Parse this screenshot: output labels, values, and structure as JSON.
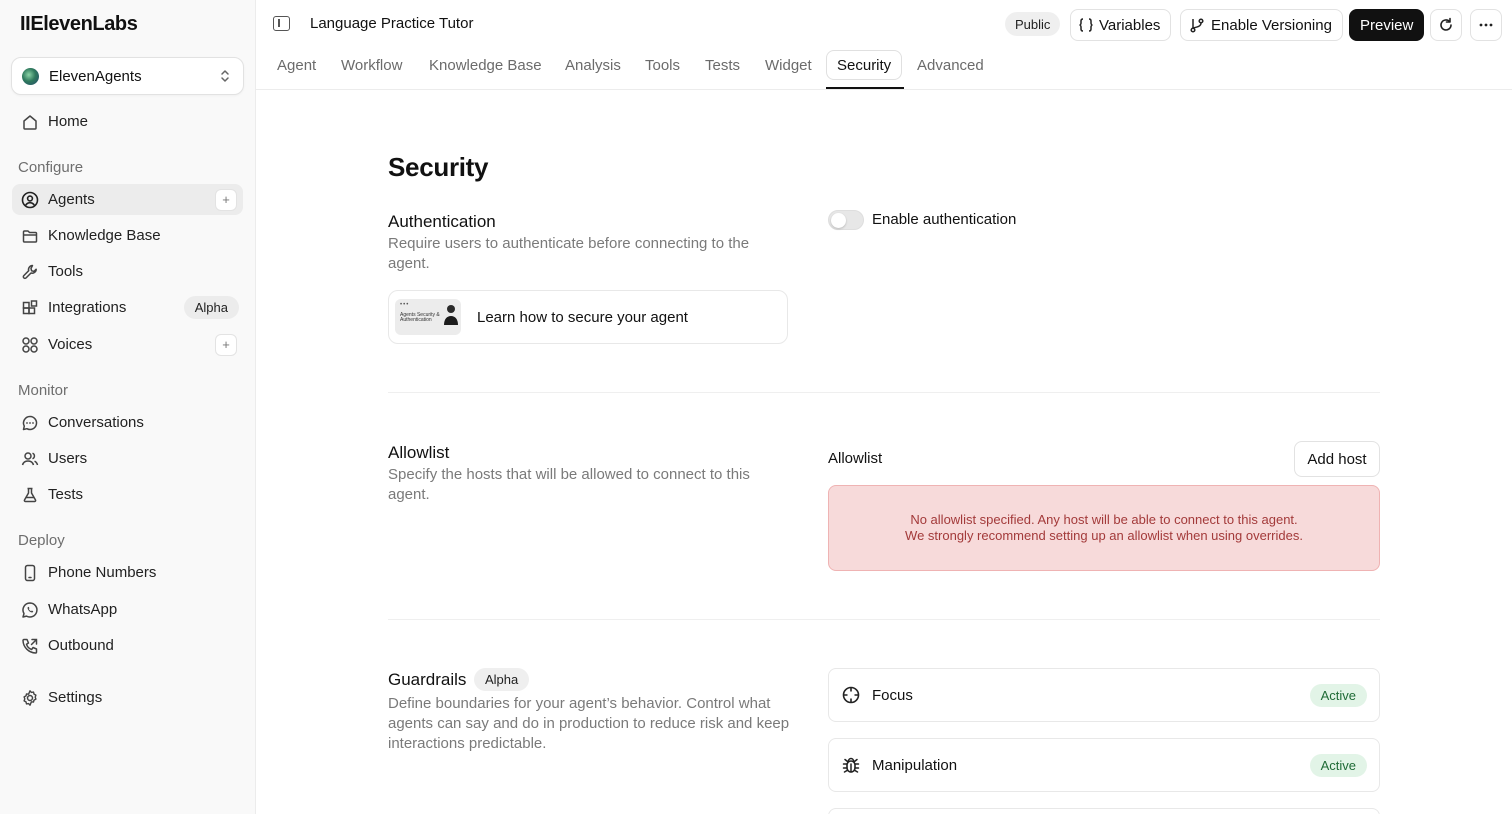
{
  "brand": {
    "logo": "IIElevenLabs"
  },
  "workspace": {
    "name": "ElevenAgents",
    "icon": "workspace-orb-icon"
  },
  "sidebar": {
    "home": {
      "label": "Home",
      "icon": "home-icon"
    },
    "sections": {
      "configure": "Configure",
      "monitor": "Monitor",
      "deploy": "Deploy"
    },
    "configure_items": [
      {
        "label": "Agents",
        "icon": "agent-face-icon",
        "active": true
      },
      {
        "label": "Knowledge Base",
        "icon": "folder-icon"
      },
      {
        "label": "Tools",
        "icon": "wrench-icon"
      },
      {
        "label": "Integrations",
        "icon": "blocks-icon",
        "badge": "Alpha"
      },
      {
        "label": "Voices",
        "icon": "grid-circles-icon"
      }
    ],
    "monitor_items": [
      {
        "label": "Conversations",
        "icon": "chat-icon"
      },
      {
        "label": "Users",
        "icon": "users-icon"
      },
      {
        "label": "Tests",
        "icon": "flask-icon"
      }
    ],
    "deploy_items": [
      {
        "label": "Phone Numbers",
        "icon": "phone-icon"
      },
      {
        "label": "WhatsApp",
        "icon": "whatsapp-icon"
      },
      {
        "label": "Outbound",
        "icon": "phone-outgoing-icon"
      }
    ],
    "settings": {
      "label": "Settings",
      "icon": "gear-icon"
    }
  },
  "header": {
    "agent_name": "Language Practice Tutor",
    "visibility": "Public",
    "variables_label": "Variables",
    "versioning_label": "Enable Versioning",
    "preview_label": "Preview"
  },
  "tabs": [
    "Agent",
    "Workflow",
    "Knowledge Base",
    "Analysis",
    "Tools",
    "Tests",
    "Widget",
    "Security",
    "Advanced"
  ],
  "active_tab": "Security",
  "page": {
    "title": "Security",
    "authentication": {
      "title": "Authentication",
      "description": "Require users to authenticate before connecting to the agent.",
      "toggle_label": "Enable authentication",
      "toggle_on": false,
      "learn_card": {
        "text": "Learn how to secure your agent",
        "thumb_dots": "•••",
        "thumb_text": "Agents Security & Authentication"
      }
    },
    "allowlist": {
      "title": "Allowlist",
      "description": "Specify the hosts that will be allowed to connect to this agent.",
      "label": "Allowlist",
      "add_button": "Add host",
      "warning_line1": "No allowlist specified. Any host will be able to connect to this agent.",
      "warning_line2": "We strongly recommend setting up an allowlist when using overrides."
    },
    "guardrails": {
      "title": "Guardrails",
      "badge": "Alpha",
      "description": "Define boundaries for your agent’s behavior. Control what agents can say and do in production to reduce risk and keep interactions predictable.",
      "items": [
        {
          "name": "Focus",
          "status": "Active",
          "icon": "crosshair-icon"
        },
        {
          "name": "Manipulation",
          "status": "Active",
          "icon": "bug-icon"
        }
      ]
    }
  }
}
